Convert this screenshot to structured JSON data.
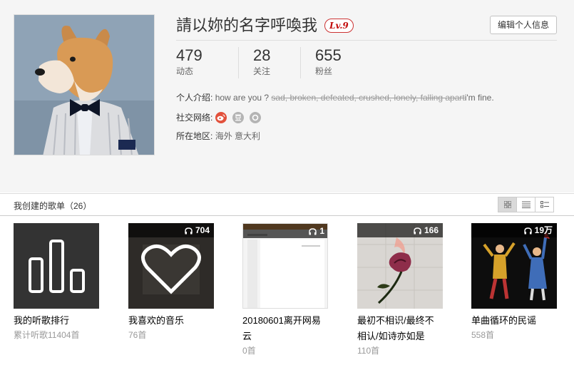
{
  "profile": {
    "name": "請以妳的名字呼喚我",
    "level": "Lv.9",
    "edit_label": "编辑个人信息",
    "stats": [
      {
        "num": "479",
        "label": "动态"
      },
      {
        "num": "28",
        "label": "关注"
      },
      {
        "num": "655",
        "label": "粉丝"
      }
    ],
    "intro_label": "个人介绍:",
    "intro_prefix": "how are you ?",
    "intro_strike": "sad, broken, defeated, crushed, lonely, falling apart",
    "intro_suffix": "i'm fine.",
    "social_label": "社交网络:",
    "social_icons": [
      "weibo-icon",
      "douban-icon",
      "other-social-icon"
    ],
    "region_label": "所在地区:",
    "region_value": "海外 意大利"
  },
  "section": {
    "title": "我创建的歌单（26）",
    "views": [
      "grid-view-icon",
      "list-view-icon",
      "detail-view-icon"
    ]
  },
  "playlists": [
    {
      "title": "我的听歌排行",
      "sub": "累计听歌11404首",
      "count": ""
    },
    {
      "title": "我喜欢的音乐",
      "sub": "76首",
      "count": "704"
    },
    {
      "title": "20180601离开网易云",
      "sub": "0首",
      "count": "1"
    },
    {
      "title": "最初不相识/最终不相认/如诗亦如是",
      "sub": "110首",
      "count": "166"
    },
    {
      "title": "单曲循环的民谣",
      "sub": "558首",
      "count": "19万"
    }
  ],
  "colors": {
    "accent": "#c20c0c",
    "weibo": "#e2513c",
    "muted": "#999999"
  }
}
